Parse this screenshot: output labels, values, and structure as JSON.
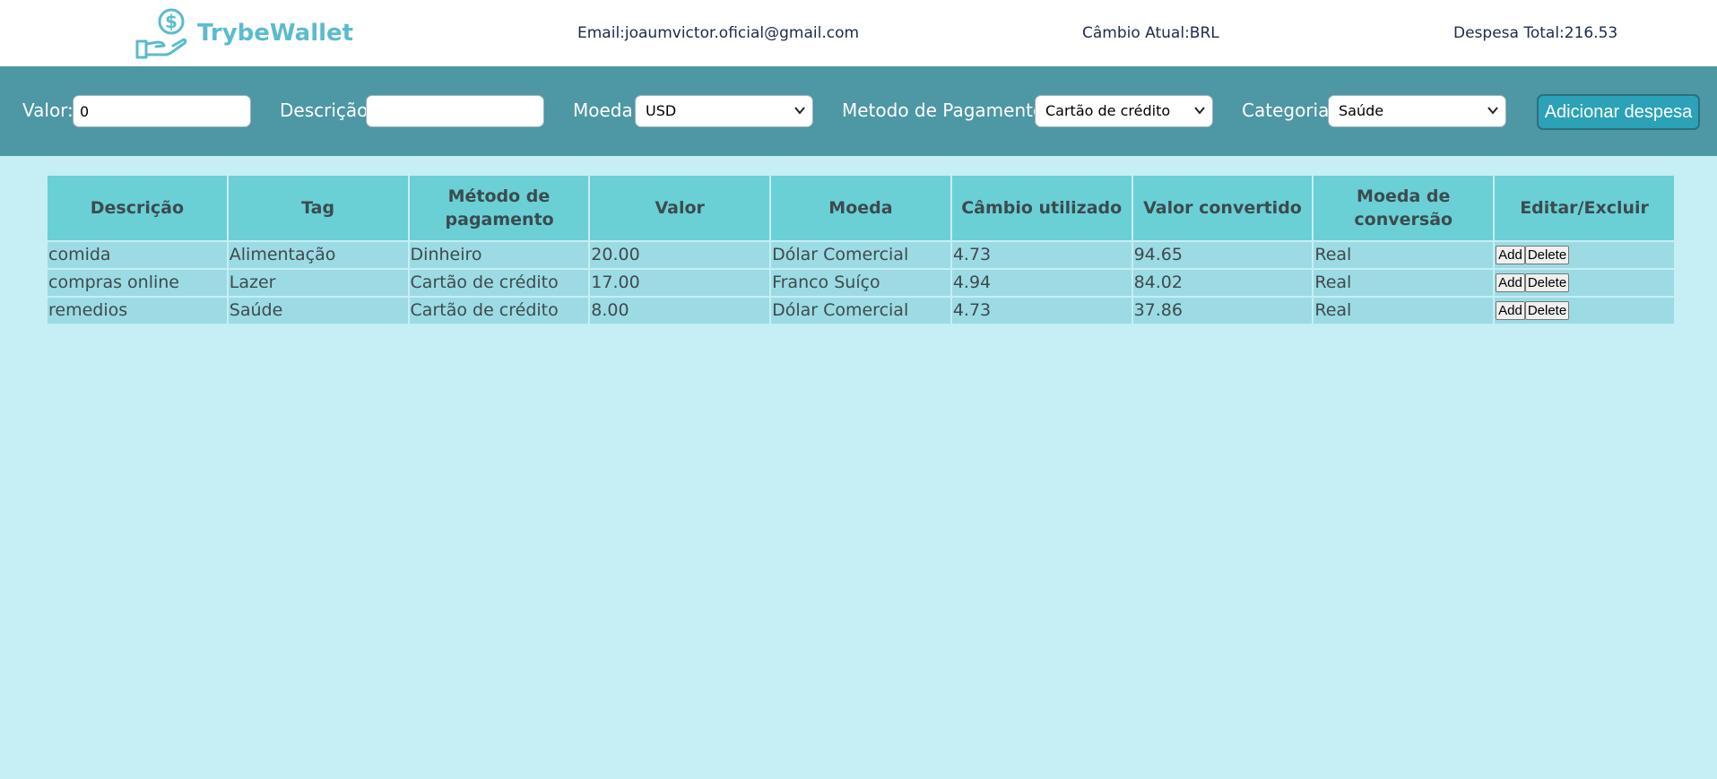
{
  "header": {
    "logo_text": "TrybeWallet",
    "email": "Email:joaumvictor.oficial@gmail.com",
    "cambio": "Câmbio Atual:BRL",
    "total": "Despesa Total:216.53"
  },
  "form": {
    "valor_label": "Valor:",
    "valor_value": "0",
    "descricao_label": "Descrição:",
    "descricao_value": "",
    "moeda_label": "Moeda",
    "moeda_selected": "USD",
    "metodo_label": "Metodo de Pagamento:",
    "metodo_selected": "Cartão de crédito",
    "categoria_label": "Categoria:",
    "categoria_selected": "Saúde",
    "add_button": "Adicionar despesa"
  },
  "table": {
    "headers": [
      "Descrição",
      "Tag",
      "Método de pagamento",
      "Valor",
      "Moeda",
      "Câmbio utilizado",
      "Valor convertido",
      "Moeda de conversão",
      "Editar/Excluir"
    ],
    "rows": [
      {
        "descricao": "comida",
        "tag": "Alimentação",
        "metodo": "Dinheiro",
        "valor": "20.00",
        "moeda": "Dólar Comercial",
        "cambio": "4.73",
        "convertido": "94.65",
        "moeda_conversao": "Real",
        "edit_label": "Add",
        "delete_label": "Delete"
      },
      {
        "descricao": "compras online",
        "tag": "Lazer",
        "metodo": "Cartão de crédito",
        "valor": "17.00",
        "moeda": "Franco Suíço",
        "cambio": "4.94",
        "convertido": "84.02",
        "moeda_conversao": "Real",
        "edit_label": "Add",
        "delete_label": "Delete"
      },
      {
        "descricao": "remedios",
        "tag": "Saúde",
        "metodo": "Cartão de crédito",
        "valor": "8.00",
        "moeda": "Dólar Comercial",
        "cambio": "4.73",
        "convertido": "37.86",
        "moeda_conversao": "Real",
        "edit_label": "Add",
        "delete_label": "Delete"
      }
    ]
  },
  "colors": {
    "page_bg": "#c6eef5",
    "form_bar": "#4e97a4",
    "brand": "#5abccd",
    "header_cell": "#6ad0d6",
    "body_cell": "#9cdbe4",
    "add_button": "#2ba2b7"
  },
  "icons": {
    "logo": "hand-coin-icon",
    "select_arrow": "chevron-down-icon"
  }
}
